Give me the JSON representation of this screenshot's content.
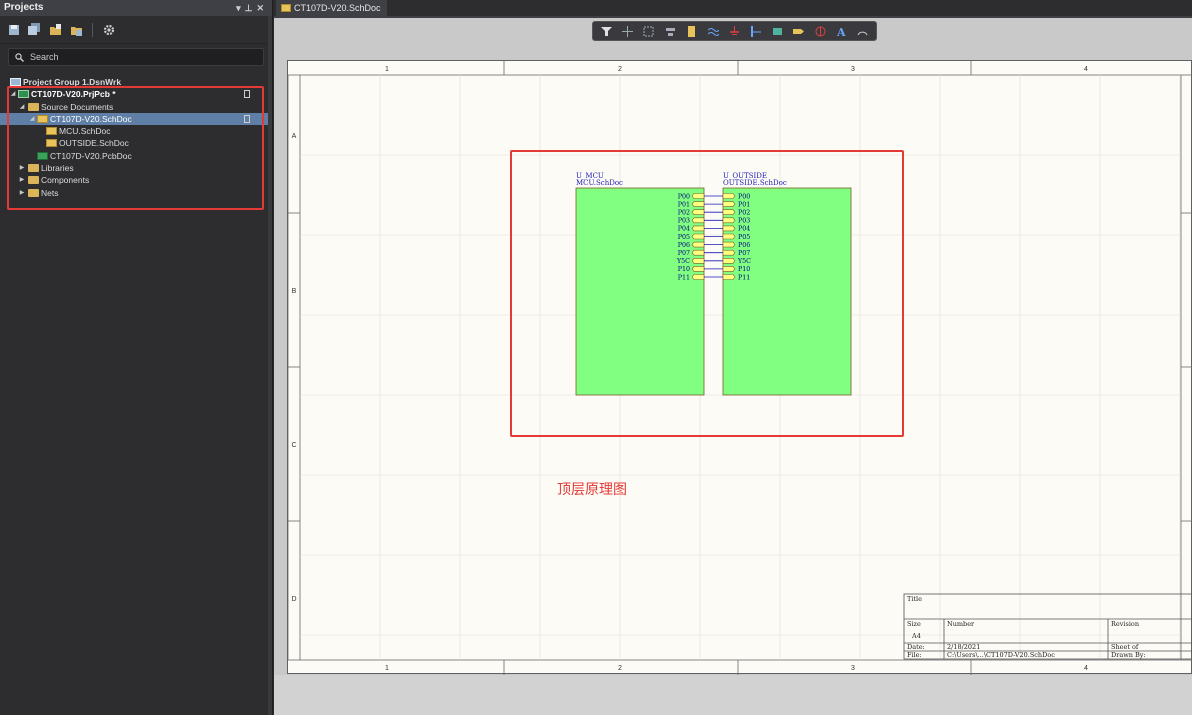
{
  "panel": {
    "title": "Projects",
    "search_placeholder": "Search",
    "tree": [
      {
        "label": "Project Group 1.DsnWrk",
        "type": "group"
      },
      {
        "label": "CT107D-V20.PrjPcb *",
        "type": "project"
      },
      {
        "label": "Source Documents",
        "type": "folder"
      },
      {
        "label": "CT107D-V20.SchDoc",
        "type": "schdoc",
        "selected": true
      },
      {
        "label": "MCU.SchDoc",
        "type": "schdoc"
      },
      {
        "label": "OUTSIDE.SchDoc",
        "type": "schdoc"
      },
      {
        "label": "CT107D-V20.PcbDoc",
        "type": "pcbdoc"
      },
      {
        "label": "Libraries",
        "type": "folder"
      },
      {
        "label": "Components",
        "type": "folder"
      },
      {
        "label": "Nets",
        "type": "folder"
      }
    ]
  },
  "document": {
    "tab_label": "CT107D-V20.SchDoc",
    "zone_columns": [
      "1",
      "2",
      "3",
      "4"
    ],
    "zone_rows": [
      "A",
      "B",
      "C",
      "D"
    ],
    "caption": "顶层原理图",
    "highlight_color": "#e53935",
    "sheet_fill": "#80ff80"
  },
  "schematic": {
    "sheets": [
      {
        "designator": "U_MCU",
        "filename": "MCU.SchDoc",
        "side": "right"
      },
      {
        "designator": "U_OUTSIDE",
        "filename": "OUTSIDE.SchDoc",
        "side": "left"
      }
    ],
    "ports": [
      "P00",
      "P01",
      "P02",
      "P03",
      "P04",
      "P05",
      "P06",
      "P07",
      "Y5C",
      "P10",
      "P11"
    ]
  },
  "title_block": {
    "title_label": "Title",
    "size_label": "Size",
    "size_value": "A4",
    "number_label": "Number",
    "revision_label": "Revision",
    "date_label": "Date:",
    "date_value": "2/18/2021",
    "file_label": "File:",
    "file_value": "C:\\Users\\...\\CT107D-V20.SchDoc",
    "sheet_label": "Sheet   of",
    "drawn_by_label": "Drawn By:"
  }
}
